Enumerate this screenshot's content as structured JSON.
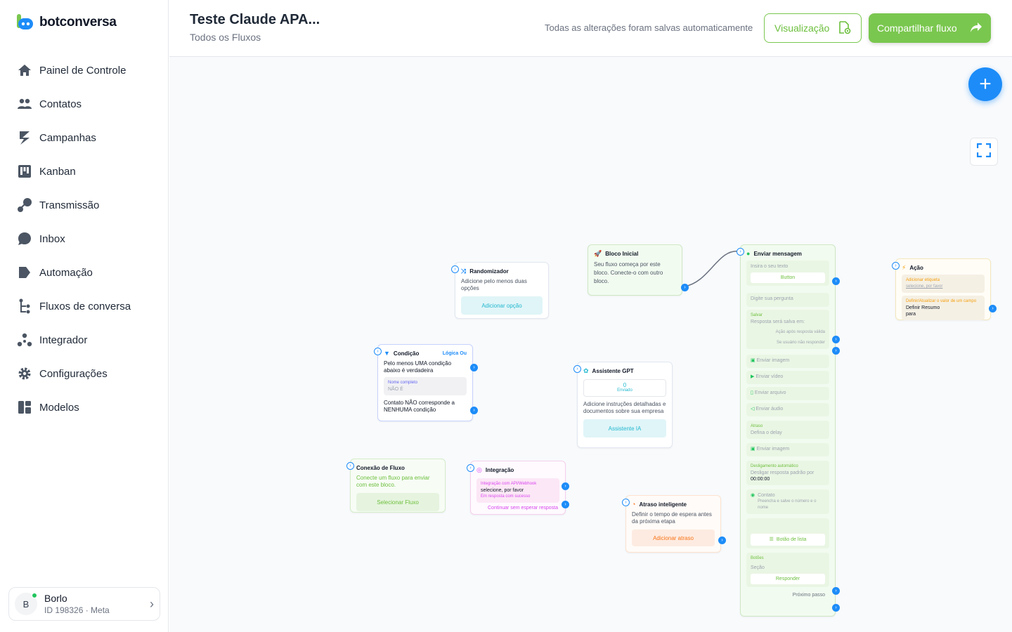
{
  "brand": {
    "name": "botconversa",
    "accent": "#1d8cf8",
    "green": "#7ac74f"
  },
  "sidebar": {
    "items": [
      {
        "label": "Painel de Controle",
        "icon": "home-icon"
      },
      {
        "label": "Contatos",
        "icon": "users-icon"
      },
      {
        "label": "Campanhas",
        "icon": "campaign-icon"
      },
      {
        "label": "Kanban",
        "icon": "kanban-icon"
      },
      {
        "label": "Transmissão",
        "icon": "broadcast-icon"
      },
      {
        "label": "Inbox",
        "icon": "chat-icon"
      },
      {
        "label": "Automação",
        "icon": "automation-icon"
      },
      {
        "label": "Fluxos de conversa",
        "icon": "flow-icon"
      },
      {
        "label": "Integrador",
        "icon": "integrator-icon"
      },
      {
        "label": "Configurações",
        "icon": "gear-icon"
      },
      {
        "label": "Modelos",
        "icon": "templates-icon"
      }
    ]
  },
  "account": {
    "initial": "B",
    "name": "Borlo",
    "id": "ID 198326 · Meta"
  },
  "header": {
    "title": "Teste Claude APA...",
    "subtitle": "Todos os Fluxos",
    "saved": "Todas as alterações foram salvas automaticamente",
    "preview": "Visualização",
    "share": "Compartilhar fluxo"
  },
  "nodes": {
    "randomizer": {
      "title": "Randomizador",
      "desc": "Adicione pelo menos duas opções",
      "button": "Adicionar opção"
    },
    "start": {
      "title": "Bloco Inicial",
      "desc": "Seu fluxo começa por este bloco. Conecte-o com outro bloco."
    },
    "condition": {
      "title": "Condição",
      "logic": "Lógica Ou",
      "desc": "Pelo menos UMA condição abaixo é verdadeira",
      "field_label": "Nome completo",
      "field_value": "NÃO É",
      "else": "Contato NÃO corresponde a NENHUMA condição"
    },
    "gpt": {
      "title": "Assistente GPT",
      "count": "0",
      "count_label": "Enviado",
      "desc": "Adicione instruções detalhadas e documentos sobre sua empresa",
      "button": "Assistente IA"
    },
    "flowconn": {
      "title": "Conexão de Fluxo",
      "desc": "Conecte um fluxo para enviar com este bloco.",
      "button": "Selecionar Fluxo"
    },
    "integration": {
      "title": "Integração",
      "label": "Integração com API/Webhook",
      "value": "selecione, por favor",
      "success": "Em resposta com sucesso",
      "cont": "Continuar sem esperar resposta"
    },
    "delay": {
      "title": "Atraso inteligente",
      "desc": "Definir o tempo de espera antes da próxima etapa",
      "button": "Adicionar atraso"
    },
    "send": {
      "title": "Enviar mensagem",
      "text_placeholder": "Insira o seu texto",
      "button": "Button",
      "question": "Digite sua pergunta",
      "save_label": "Salvar",
      "save_desc": "Resposta será salva em:",
      "valid": "Ação após resposta válida",
      "noreply": "Se usuário não responder",
      "img": "Enviar imagem",
      "video": "Enviar vídeo",
      "file": "Enviar arquivo",
      "audio": "Enviar áudio",
      "delay_label": "Atraso",
      "delay_desc": "Defina o delay",
      "img2": "Enviar imagem",
      "off_label": "Desligamento automático",
      "off_desc": "Desligar resposta padrão por",
      "off_time": "00:00:00",
      "contact_label": "Contato",
      "contact_desc": "Preencha e salve o número e o nome",
      "list_btn": "Botão de lista",
      "buttons_label": "Botões",
      "section": "Seção",
      "reply": "Responder",
      "next": "Próximo passo"
    },
    "action": {
      "title": "Ação",
      "tag_label": "Adicionar etiqueta",
      "tag_value": "selecione, por favor",
      "field_label": "Definir/Atualizar o valor de um campo",
      "field_value": "Definir Resumo",
      "field_value2": "para"
    }
  }
}
